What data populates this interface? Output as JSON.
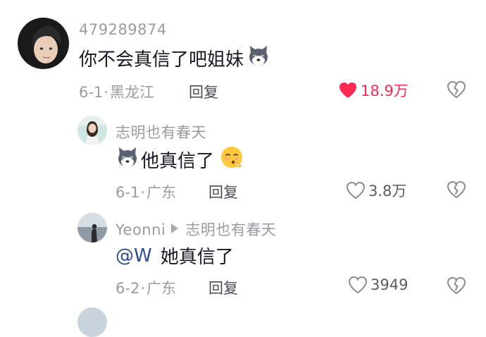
{
  "comments": [
    {
      "username": "479289874",
      "text": "你不会真信了吧姐妹",
      "emoji_after": "husky-emoji",
      "date": "6-1",
      "location": "黑龙江",
      "reply_label": "回复",
      "likes": "18.9万",
      "liked": true,
      "like_color": "#fe2c55",
      "avatar_icon": "child-portrait-avatar"
    },
    {
      "username": "志明也有春天",
      "emoji_before": "husky-emoji",
      "text": "他真信了",
      "emoji_after": "smirk-emoji",
      "date": "6-1",
      "location": "广东",
      "reply_label": "回复",
      "likes": "3.8万",
      "liked": false,
      "avatar_icon": "woman-portrait-avatar"
    },
    {
      "username": "Yeonni",
      "reply_to": "志明也有春天",
      "mention": "@W",
      "text": "她真信了",
      "date": "6-2",
      "location": "广东",
      "reply_label": "回复",
      "likes": "3949",
      "liked": false,
      "avatar_icon": "seaside-figure-avatar"
    }
  ],
  "separator": "·",
  "colors": {
    "like_active": "#fe2c55",
    "mention": "#2d4c8a",
    "secondary_text": "#9a9ba3"
  }
}
